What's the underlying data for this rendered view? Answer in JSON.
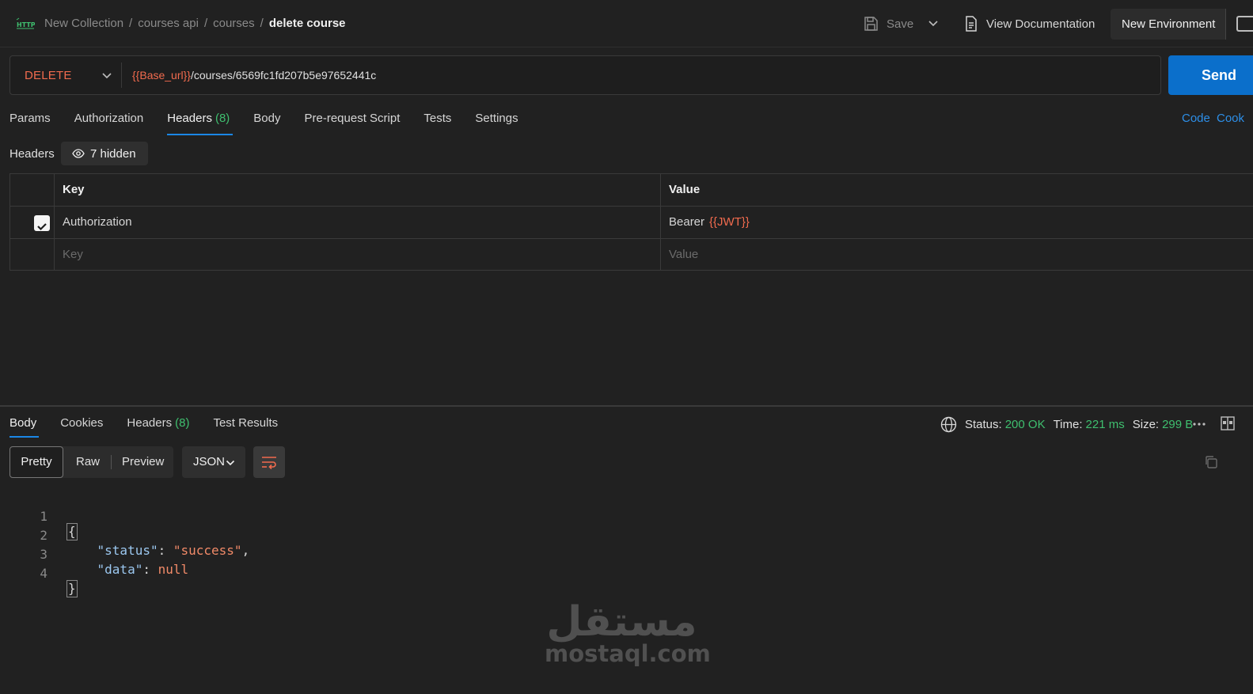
{
  "breadcrumb": {
    "items": [
      "New Collection",
      "courses api",
      "courses"
    ],
    "current": "delete course",
    "separator": "/"
  },
  "toolbar": {
    "save_label": "Save",
    "view_docs_label": "View Documentation",
    "environment_label": "New Environment"
  },
  "request": {
    "method": "DELETE",
    "url_variable": "{{Base_url}}",
    "url_path": "/courses/6569fc1fd207b5e97652441c",
    "send_label": "Send"
  },
  "request_tabs": {
    "items": [
      {
        "label": "Params"
      },
      {
        "label": "Authorization"
      },
      {
        "label": "Headers",
        "count": "(8)"
      },
      {
        "label": "Body"
      },
      {
        "label": "Pre-request Script"
      },
      {
        "label": "Tests"
      },
      {
        "label": "Settings"
      }
    ],
    "code_link": "Code",
    "cookies_link": "Cook"
  },
  "headers_section": {
    "label": "Headers",
    "hidden_label": "7 hidden",
    "columns": {
      "key": "Key",
      "value": "Value"
    },
    "rows": [
      {
        "key": "Authorization",
        "value_prefix": "Bearer",
        "value_variable": "{{JWT}}",
        "checked": true
      }
    ],
    "placeholder": {
      "key": "Key",
      "value": "Value"
    }
  },
  "response_tabs": {
    "items": [
      {
        "label": "Body"
      },
      {
        "label": "Cookies"
      },
      {
        "label": "Headers",
        "count": "(8)"
      },
      {
        "label": "Test Results"
      }
    ]
  },
  "response_status": {
    "status_label": "Status:",
    "status_value": "200 OK",
    "time_label": "Time:",
    "time_value": "221 ms",
    "size_label": "Size:",
    "size_value": "299 B"
  },
  "response_view": {
    "modes": [
      "Pretty",
      "Raw",
      "Preview"
    ],
    "format": "JSON"
  },
  "response_body": {
    "line_numbers": [
      "1",
      "2",
      "3",
      "4"
    ],
    "open_brace": "{",
    "close_brace": "}",
    "entries": [
      {
        "key": "\"status\"",
        "value": "\"success\"",
        "trail": ","
      },
      {
        "key": "\"data\"",
        "value": "null",
        "trail": ""
      }
    ]
  },
  "watermark": {
    "arabic": "مستقل",
    "latin": "mostaql.com"
  },
  "colors": {
    "accent": "#0b6fcb",
    "method": "#f16b4e",
    "success": "#3fbf6f",
    "background": "#212121"
  }
}
